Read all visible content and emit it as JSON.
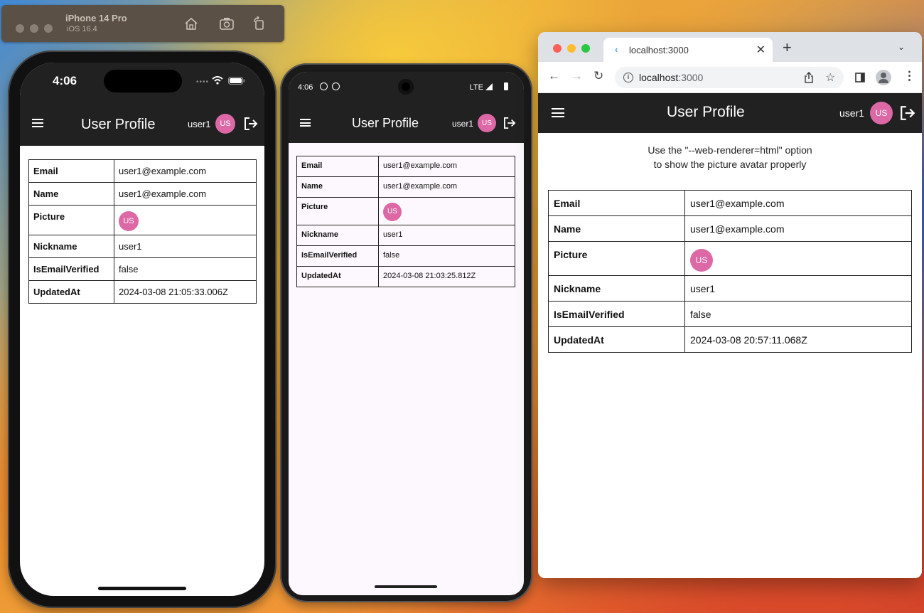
{
  "simulator": {
    "device": "iPhone 14 Pro",
    "os": "iOS 16.4"
  },
  "ios": {
    "time": "4:06",
    "appbar": {
      "title": "User Profile",
      "user": "user1",
      "avatar": "US"
    },
    "rows": [
      {
        "key": "Email",
        "value": "user1@example.com"
      },
      {
        "key": "Name",
        "value": "user1@example.com"
      },
      {
        "key": "Picture",
        "avatar": "US"
      },
      {
        "key": "Nickname",
        "value": "user1"
      },
      {
        "key": "IsEmailVerified",
        "value": "false"
      },
      {
        "key": "UpdatedAt",
        "value": "2024-03-08 21:05:33.006Z"
      }
    ]
  },
  "android": {
    "time": "4:06",
    "network": "LTE",
    "appbar": {
      "title": "User Profile",
      "user": "user1",
      "avatar": "US"
    },
    "rows": [
      {
        "key": "Email",
        "value": "user1@example.com"
      },
      {
        "key": "Name",
        "value": "user1@example.com"
      },
      {
        "key": "Picture",
        "avatar": "US"
      },
      {
        "key": "Nickname",
        "value": "user1"
      },
      {
        "key": "IsEmailVerified",
        "value": "false"
      },
      {
        "key": "UpdatedAt",
        "value": "2024-03-08 21:03:25.812Z"
      }
    ]
  },
  "browser": {
    "tab_title": "localhost:3000",
    "url_host": "localhost",
    "url_port": ":3000",
    "appbar": {
      "title": "User Profile",
      "user": "user1",
      "avatar": "US"
    },
    "notice_line1": "Use the \"--web-renderer=html\" option",
    "notice_line2": "to show the picture avatar properly",
    "rows": [
      {
        "key": "Email",
        "value": "user1@example.com"
      },
      {
        "key": "Name",
        "value": "user1@example.com"
      },
      {
        "key": "Picture",
        "avatar": "US"
      },
      {
        "key": "Nickname",
        "value": "user1"
      },
      {
        "key": "IsEmailVerified",
        "value": "false"
      },
      {
        "key": "UpdatedAt",
        "value": "2024-03-08 20:57:11.068Z"
      }
    ]
  },
  "colors": {
    "appbar": "#212121",
    "avatar": "#dd68a6",
    "traffic_red": "#fe5f57",
    "traffic_yellow": "#febc2e",
    "traffic_green": "#28c840"
  },
  "icons": [
    "menu-icon",
    "logout-icon",
    "home-icon",
    "screenshot-icon",
    "rotate-icon",
    "wifi-icon",
    "battery-icon",
    "back-icon",
    "forward-icon",
    "reload-icon",
    "share-icon",
    "star-icon",
    "sidepanel-icon",
    "profile-icon",
    "kebab-icon"
  ]
}
